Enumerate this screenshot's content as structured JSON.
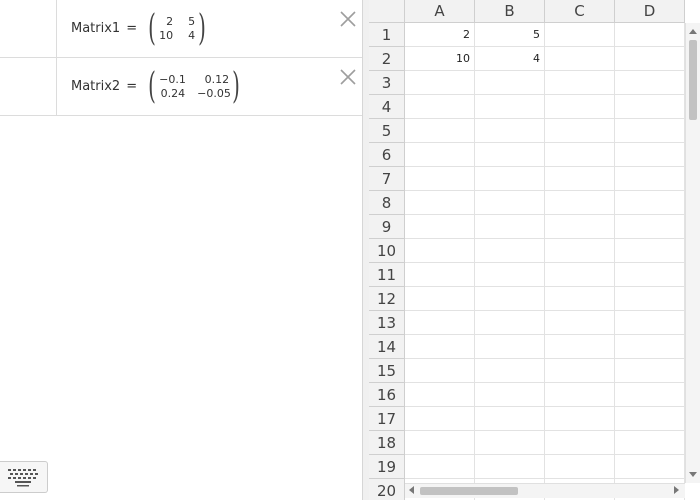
{
  "algebra": {
    "entries": [
      {
        "name": "Matrix1",
        "eq": "=",
        "rows": [
          [
            "2",
            "5"
          ],
          [
            "10",
            "4"
          ]
        ]
      },
      {
        "name": "Matrix2",
        "eq": "=",
        "rows": [
          [
            "−0.1",
            "0.12"
          ],
          [
            "0.24",
            "−0.05"
          ]
        ]
      }
    ]
  },
  "icons": {
    "delete": "close-icon",
    "keyboard": "keyboard-icon"
  },
  "spreadsheet": {
    "columns": [
      "A",
      "B",
      "C",
      "D"
    ],
    "rows": [
      "1",
      "2",
      "3",
      "4",
      "5",
      "6",
      "7",
      "8",
      "9",
      "10",
      "11",
      "12",
      "13",
      "14",
      "15",
      "16",
      "17",
      "18",
      "19",
      "20"
    ],
    "cells": {
      "A1": "2",
      "B1": "5",
      "A2": "10",
      "B2": "4"
    }
  },
  "colors": {
    "grid": "#e2e2e2",
    "header_bg": "#f2f2f2",
    "close_icon": "#9e9e9e"
  }
}
